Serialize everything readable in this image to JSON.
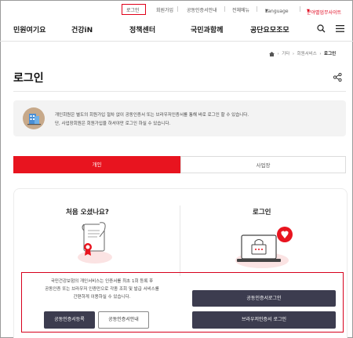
{
  "utility_bar": {
    "login": "로그인",
    "signup": "회원가입",
    "cert_guide": "공동인증서안내",
    "all_menu": "전체메뉴",
    "language": "Language",
    "related_sites": "분야별업무사이트"
  },
  "nav": {
    "items": [
      "민원여기요",
      "건강iN",
      "정책센터",
      "국민과함께",
      "공단요모조모"
    ]
  },
  "breadcrumb": {
    "items": [
      "기타",
      "회원서비스",
      "로그인"
    ]
  },
  "page": {
    "title": "로그인"
  },
  "notice": {
    "line1": "개인회원은 별도의 회원가입 절차 없이 공동인증서 또는 브라우저인증서를 통해 바로 로그인 할 수 있습니다.",
    "line2": "단, 사업장회원은 회원가입을 하셔야만 로그인 하실 수 있습니다."
  },
  "tabs": {
    "personal": "개인",
    "business": "사업장"
  },
  "left_panel": {
    "heading": "처음 오셨나요?",
    "desc_line1": "국민건강보험의 개인서비스는 인증서를 최초 1회 등록 후",
    "desc_line2": "공동인증 또는 브라우저 인증만으로 각종 조회 및 발급 서비스를",
    "desc_line3": "간편하게 이용하실 수 있습니다.",
    "register_button": "공동인증서등록",
    "guide_button": "공동인증서안내"
  },
  "right_panel": {
    "heading": "로그인",
    "cert_login_button": "공동인증서로그인",
    "browser_login_button": "브라우저인증서 로그인"
  },
  "colors": {
    "accent_red": "#e8141f",
    "button_dark": "#3c3c4f"
  }
}
